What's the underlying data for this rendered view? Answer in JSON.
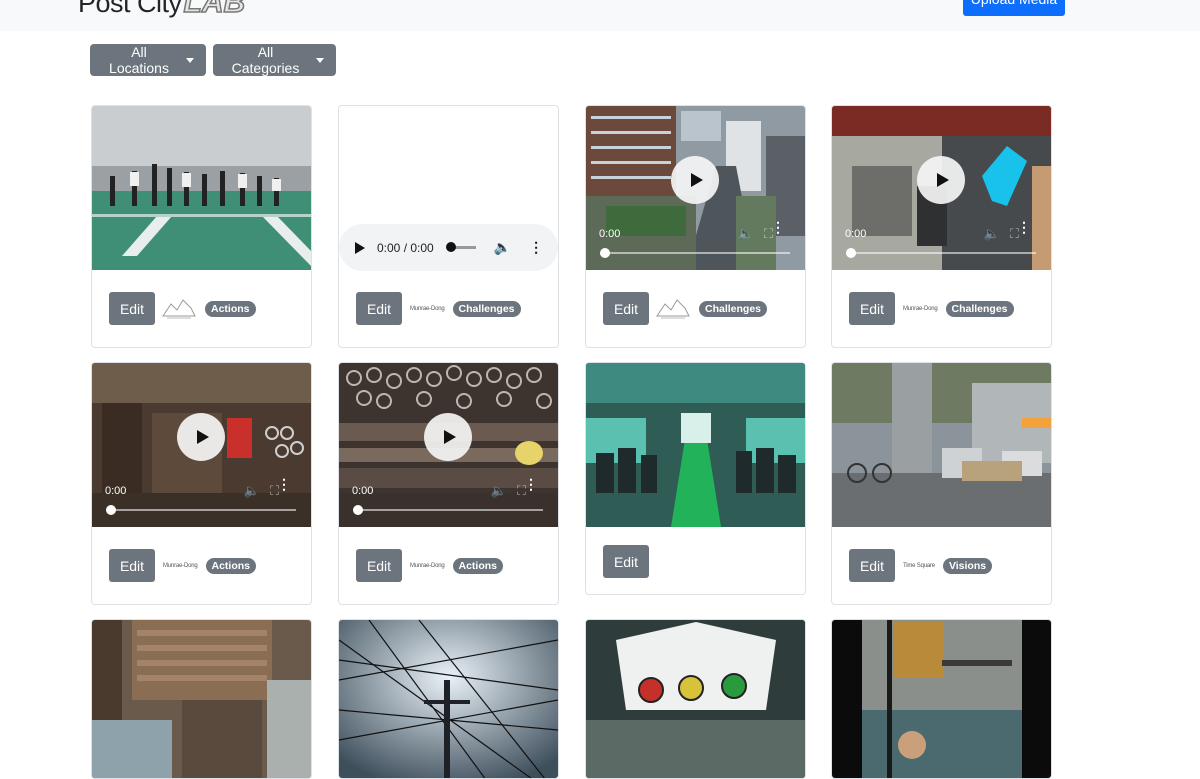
{
  "navbar": {
    "brand_text": "Post City",
    "brand_lab": "LAB",
    "upload_label": "Upload Media"
  },
  "filters": {
    "locations_label": "All Locations",
    "categories_label": "All Categories"
  },
  "common": {
    "edit_label": "Edit",
    "audio_time": "0:00 / 0:00",
    "video_time": "0:00"
  },
  "cards": [
    {
      "type": "image",
      "place": "",
      "badge": "Actions"
    },
    {
      "type": "audio",
      "place": "Munrae-Dong",
      "badge": "Challenges"
    },
    {
      "type": "video",
      "place": "",
      "badge": "Challenges"
    },
    {
      "type": "video",
      "place": "Munrae-Dong",
      "badge": "Challenges"
    },
    {
      "type": "video",
      "place": "Munrae-Dong",
      "badge": "Actions"
    },
    {
      "type": "video",
      "place": "Munrae-Dong",
      "badge": "Actions"
    },
    {
      "type": "image",
      "place": "",
      "badge": ""
    },
    {
      "type": "image",
      "place": "Time Square",
      "badge": "Visions"
    },
    {
      "type": "image",
      "place": "",
      "badge": ""
    },
    {
      "type": "image",
      "place": "",
      "badge": ""
    },
    {
      "type": "image",
      "place": "",
      "badge": ""
    },
    {
      "type": "image",
      "place": "",
      "badge": ""
    }
  ]
}
